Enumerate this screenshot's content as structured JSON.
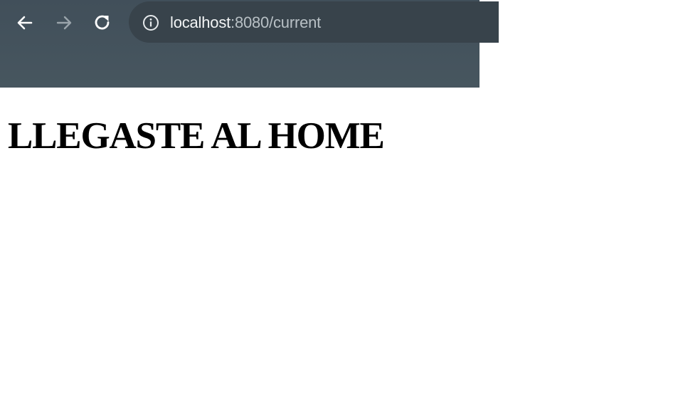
{
  "browser": {
    "url_host": "localhost",
    "url_rest": ":8080/current",
    "icons": {
      "back": "arrow-left-icon",
      "forward": "arrow-right-icon",
      "reload": "reload-icon",
      "site_info": "info-icon"
    },
    "colors": {
      "toolbar": "#445059",
      "omnibox": "#38434b",
      "icon_active": "#ffffff",
      "icon_disabled": "#9aa4ab"
    }
  },
  "page": {
    "heading": "LLEGASTE AL HOME"
  }
}
